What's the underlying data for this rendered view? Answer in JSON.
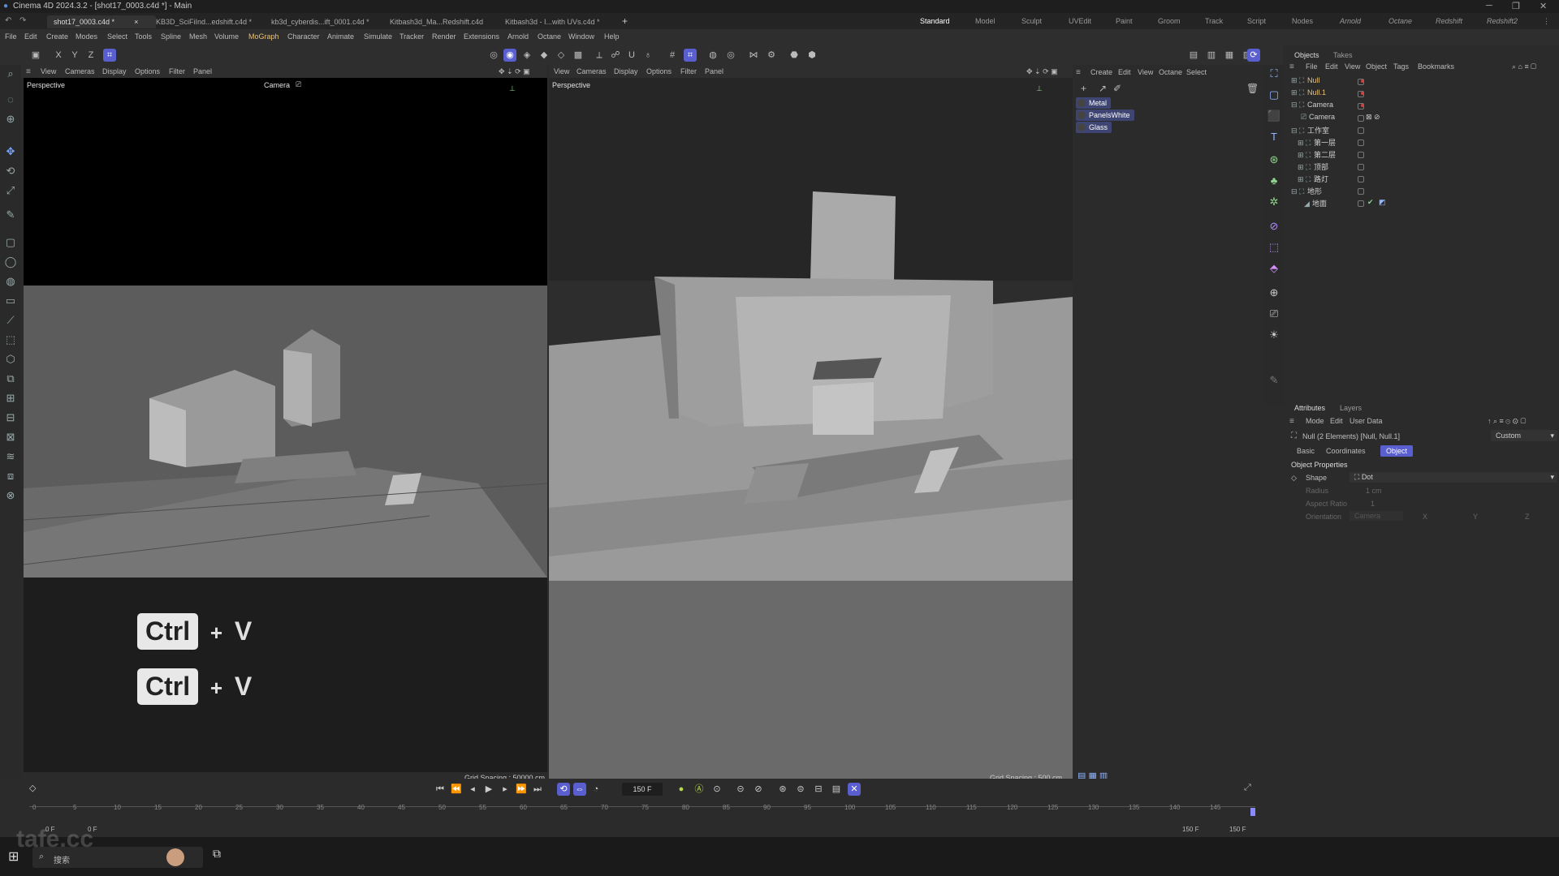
{
  "titlebar": {
    "title": "Cinema 4D 2024.3.2 - [shot17_0003.c4d *] - Main"
  },
  "tabs": [
    {
      "label": "shot17_0003.c4d *"
    },
    {
      "label": "KB3D_SciFiInd...edshift.c4d *"
    },
    {
      "label": "kb3d_cyberdis...ift_0001.c4d *"
    },
    {
      "label": "Kitbash3d_Ma...Redshift.c4d"
    },
    {
      "label": "Kitbash3d - I...with UVs.c4d *"
    }
  ],
  "add_tab": "+",
  "workspaces": [
    "Standard",
    "Model",
    "Sculpt",
    "UVEdit",
    "Paint",
    "Groom",
    "Track",
    "Script",
    "Nodes",
    "Arnold",
    "Octane",
    "Redshift",
    "Redshift2"
  ],
  "menus": [
    "File",
    "Edit",
    "Create",
    "Modes",
    "Select",
    "Tools",
    "Spline",
    "Mesh",
    "Volume",
    "MoGraph",
    "Character",
    "Animate",
    "Simulate",
    "Tracker",
    "Render",
    "Extensions",
    "Arnold",
    "Octane",
    "Window",
    "Help"
  ],
  "axis_labels": {
    "x": "X",
    "y": "Y",
    "z": "Z"
  },
  "viewport_left": {
    "menus": [
      "View",
      "Cameras",
      "Display",
      "Options",
      "Filter",
      "Panel"
    ],
    "label": "Perspective",
    "camera": "Camera",
    "grid": "Grid Spacing : 50000 cm"
  },
  "viewport_right": {
    "menus": [
      "View",
      "Cameras",
      "Display",
      "Options",
      "Filter",
      "Panel"
    ],
    "label": "Perspective",
    "grid": "Grid Spacing : 500 cm"
  },
  "materials_menu": [
    "Create",
    "Edit",
    "View",
    "Octane",
    "Select"
  ],
  "materials": [
    "Metal",
    "PanelsWhite",
    "Glass"
  ],
  "objects_panel": {
    "tabs": [
      "Objects",
      "Takes"
    ],
    "menus": [
      "File",
      "Edit",
      "View",
      "Object",
      "Tags",
      "Bookmarks"
    ],
    "items": [
      {
        "name": "Null",
        "color": "#e8c27a"
      },
      {
        "name": "Null.1",
        "color": "#e8c27a"
      },
      {
        "name": "Camera",
        "color": "#cfcfcf"
      },
      {
        "name": "Camera",
        "color": "#cfcfcf"
      },
      {
        "name": "工作室",
        "color": "#cfcfcf"
      },
      {
        "name": "第一层",
        "color": "#cfcfcf"
      },
      {
        "name": "第二层",
        "color": "#cfcfcf"
      },
      {
        "name": "顶部",
        "color": "#cfcfcf"
      },
      {
        "name": "路灯",
        "color": "#cfcfcf"
      },
      {
        "name": "地形",
        "color": "#cfcfcf"
      },
      {
        "name": "地面",
        "color": "#cfcfcf"
      }
    ]
  },
  "attributes_panel": {
    "tabs": [
      "Attributes",
      "Layers"
    ],
    "menus": [
      "Mode",
      "Edit",
      "User Data"
    ],
    "selection": "Null (2 Elements) [Null, Null.1]",
    "preset": "Custom",
    "subtabs": [
      "Basic",
      "Coordinates",
      "Object"
    ],
    "section": "Object Properties",
    "shape_label": "Shape",
    "shape_value": "Dot",
    "radius_label": "Radius",
    "radius_value": "1 cm",
    "aspect_label": "Aspect Ratio",
    "aspect_value": "1",
    "orientation_label": "Orientation",
    "orientation_value": "Camera",
    "orient_axes": [
      "X",
      "Y",
      "Z"
    ]
  },
  "overlay": {
    "key1": "Ctrl",
    "plus": "+",
    "key2": "V"
  },
  "timeline": {
    "current_frame": "150 F",
    "ticks": [
      "0",
      "5",
      "10",
      "15",
      "20",
      "25",
      "30",
      "35",
      "40",
      "45",
      "50",
      "55",
      "60",
      "65",
      "70",
      "75",
      "80",
      "85",
      "90",
      "95",
      "100",
      "105",
      "110",
      "115",
      "120",
      "125",
      "130",
      "135",
      "140",
      "145"
    ],
    "start_a": "0 F",
    "start_b": "0 F",
    "end_a": "150 F",
    "end_b": "150 F"
  },
  "taskbar": {
    "search_placeholder": "搜索",
    "watermark": "tafe.cc"
  },
  "colors": {
    "accent": "#5a5fd0",
    "highlight": "#e8c27a"
  }
}
